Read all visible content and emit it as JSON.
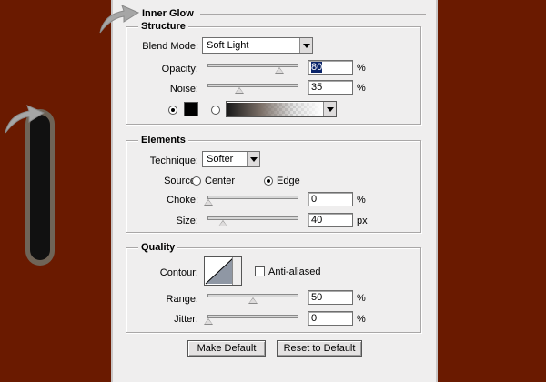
{
  "dialog": {
    "title": "Inner Glow",
    "structure": {
      "legend": "Structure",
      "blend_mode_label": "Blend Mode:",
      "blend_mode_value": "Soft Light",
      "opacity_label": "Opacity:",
      "opacity_value": "80",
      "opacity_level": 80,
      "noise_label": "Noise:",
      "noise_value": "35",
      "noise_level": 35,
      "percent": "%",
      "glow_color": "#000000"
    },
    "elements": {
      "legend": "Elements",
      "technique_label": "Technique:",
      "technique_value": "Softer",
      "source_label": "Source:",
      "source_center": "Center",
      "source_edge": "Edge",
      "choke_label": "Choke:",
      "choke_value": "0",
      "choke_level": 0,
      "size_label": "Size:",
      "size_value": "40",
      "size_level": 16,
      "percent": "%",
      "px": "px"
    },
    "quality": {
      "legend": "Quality",
      "contour_label": "Contour:",
      "anti_aliased_label": "Anti-aliased",
      "range_label": "Range:",
      "range_value": "50",
      "range_level": 50,
      "jitter_label": "Jitter:",
      "jitter_value": "0",
      "jitter_level": 0,
      "percent": "%"
    },
    "buttons": {
      "make_default": "Make Default",
      "reset_default": "Reset to Default"
    }
  },
  "colors": {
    "background": "#6a1a00",
    "panel": "#efeeee",
    "annotation_arrow": "#a6a6a6"
  }
}
